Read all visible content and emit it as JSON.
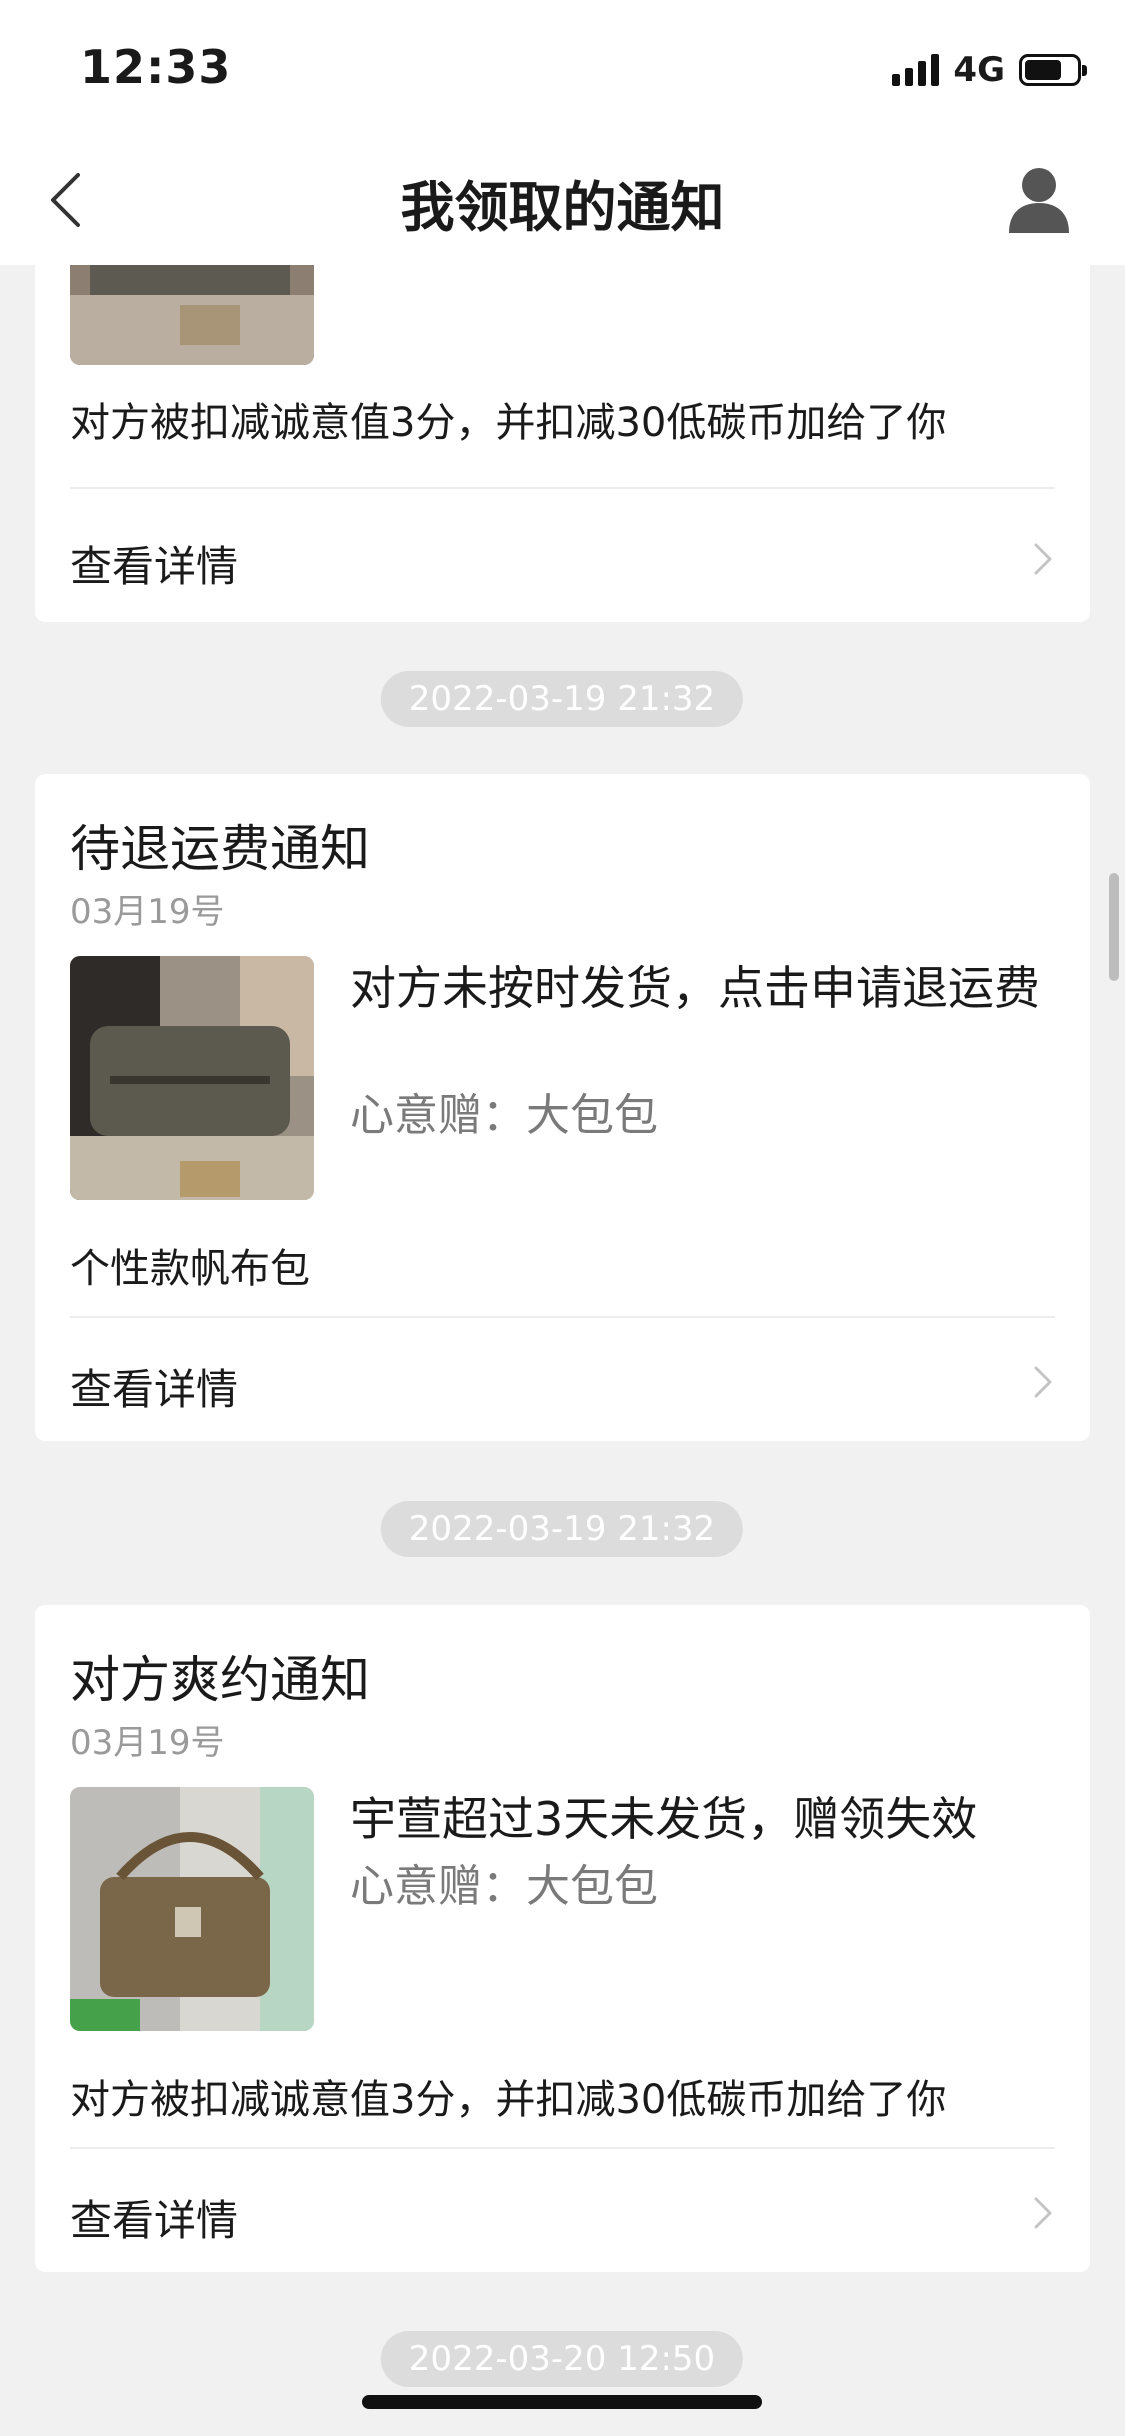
{
  "status_bar": {
    "time": "12:33",
    "network": "4G"
  },
  "nav": {
    "title": "我领取的通知",
    "back_icon": "chevron-left-icon",
    "profile_icon": "user-avatar-icon"
  },
  "detail_label": "查看详情",
  "cards": [
    {
      "extra": "对方被扣减诚意值3分，并扣减30低碳币加给了你"
    },
    {
      "timestamp": "2022-03-19 21:32",
      "title": "待退运费通知",
      "date": "03月19号",
      "message": "对方未按时发货，点击申请退运费",
      "gift": "心意赠：大包包",
      "extra": "个性款帆布包"
    },
    {
      "timestamp": "2022-03-19 21:32",
      "title": "对方爽约通知",
      "date": "03月19号",
      "message": "宇萱超过3天未发货，赠领失效",
      "gift": "心意赠：大包包",
      "extra": "对方被扣减诚意值3分，并扣减30低碳币加给了你"
    }
  ],
  "last_timestamp": "2022-03-20 12:50"
}
